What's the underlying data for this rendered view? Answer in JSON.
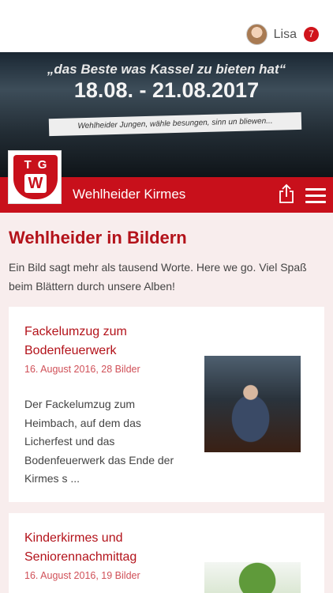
{
  "header": {
    "user_name": "Lisa",
    "notification_count": "7"
  },
  "banner": {
    "motto": "„das Beste was Kassel zu bieten hat“",
    "dates": "18.08. - 21.08.2017",
    "ribbon_text": "Wehlheider Jungen, wähle besungen, sinn un bliewen..."
  },
  "nav": {
    "title": "Wehlheider Kirmes",
    "logo_letters": "TG",
    "logo_mark": "W"
  },
  "page": {
    "title": "Wehlheider in Bildern",
    "intro": "Ein Bild sagt mehr als tausend Worte. Here we go. Viel Spaß beim Blättern durch unsere Alben!"
  },
  "albums": [
    {
      "title": "Fackelumzug zum Bodenfeuerwerk",
      "meta": "16. August 2016, 28 Bilder",
      "description": "Der Fackelumzug zum Heimbach, auf dem das Licherfest und das Bodenfeuerwerk das Ende der Kirmes s ..."
    },
    {
      "title": "Kinderkirmes und Seniorennachmittag",
      "meta": "16. August 2016, 19 Bilder"
    }
  ]
}
